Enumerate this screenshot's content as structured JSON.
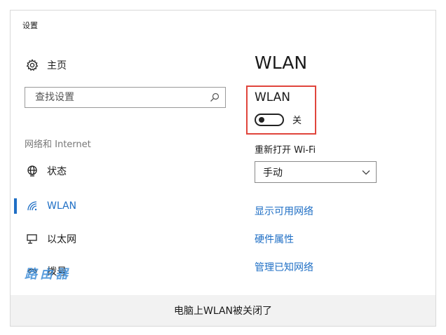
{
  "window": {
    "title": "设置"
  },
  "sidebar": {
    "home_label": "主页",
    "search_placeholder": "查找设置",
    "section_label": "网络和 Internet",
    "items": [
      {
        "label": "状态",
        "icon": "globe-icon"
      },
      {
        "label": "WLAN",
        "icon": "wifi-icon",
        "active": true
      },
      {
        "label": "以太网",
        "icon": "ethernet-icon"
      },
      {
        "label": "拨号",
        "icon": "dialup-icon"
      }
    ]
  },
  "main": {
    "page_title": "WLAN",
    "toggle": {
      "heading": "WLAN",
      "state_label": "关",
      "is_on": false
    },
    "reconnect": {
      "label": "重新打开 Wi-Fi",
      "selected": "手动"
    },
    "links": [
      "显示可用网络",
      "硬件属性",
      "管理已知网络"
    ]
  },
  "footer": {
    "caption": "电脑上WLAN被关闭了"
  },
  "watermark": {
    "text": "路由器"
  },
  "colors": {
    "accent": "#1f6fc5",
    "highlight": "#e0453c"
  }
}
